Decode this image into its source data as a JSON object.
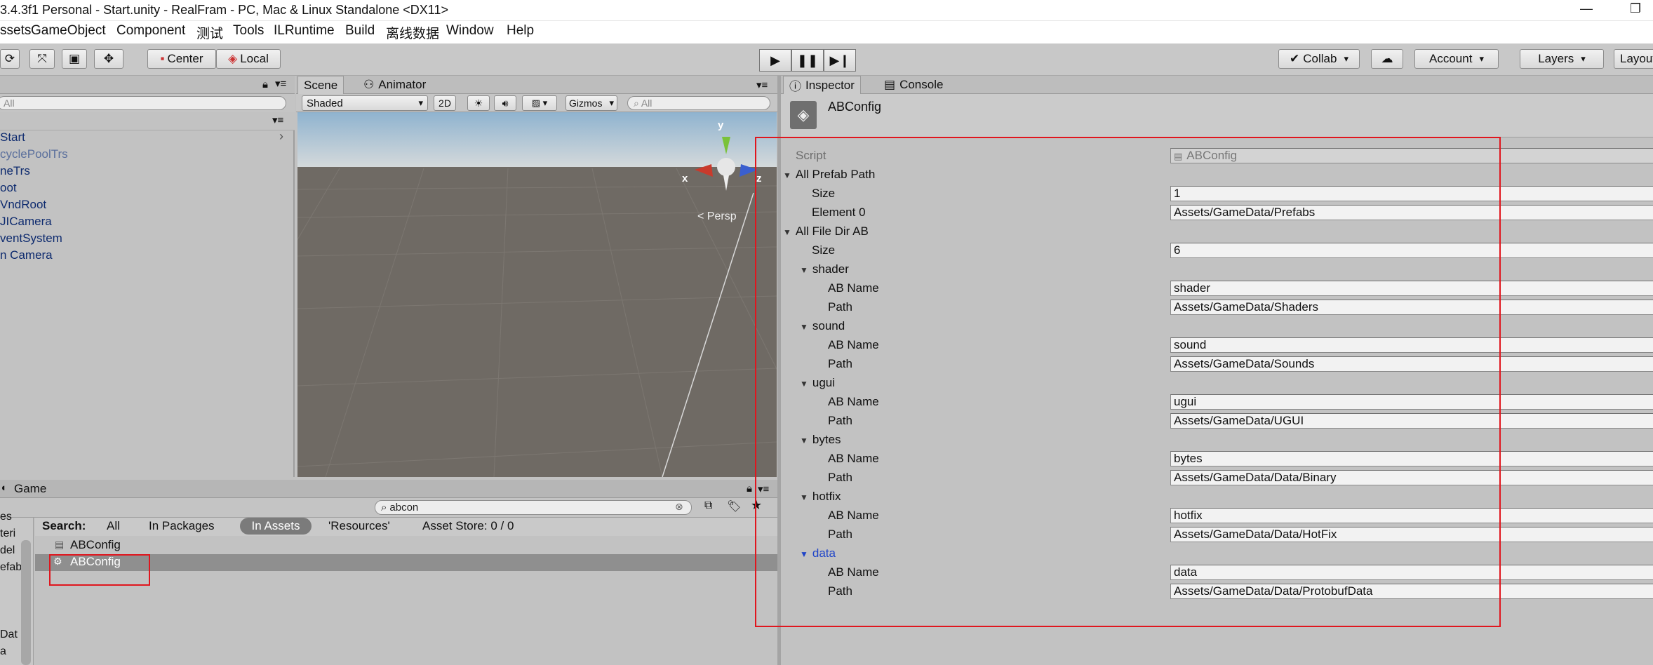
{
  "window": {
    "title": "3.4.3f1 Personal - Start.unity - RealFram - PC, Mac & Linux Standalone <DX11>"
  },
  "menu": [
    "ssets",
    "GameObject",
    "Component",
    "测试",
    "Tools",
    "ILRuntime",
    "Build",
    "离线数据",
    "Window",
    "Help"
  ],
  "toolbar": {
    "center": "Center",
    "local": "Local",
    "collab": "Collab",
    "account": "Account",
    "layers": "Layers",
    "layout": "Layout"
  },
  "hierarchy": {
    "search_placeholder": "All",
    "items": [
      "Start",
      "cyclePoolTrs",
      "neTrs",
      "oot",
      "VndRoot",
      "JICamera",
      "ventSystem",
      "n Camera"
    ]
  },
  "scene": {
    "tabs": [
      "Scene",
      "Animator"
    ],
    "shading": "Shaded",
    "mode_2d": "2D",
    "gizmos": "Gizmos",
    "search_placeholder": "All",
    "persp": "< Persp",
    "axes": {
      "x": "x",
      "y": "y",
      "z": "z"
    }
  },
  "game": {
    "tab": "Game"
  },
  "project": {
    "search_value": "abcon",
    "search_label": "Search:",
    "filters": [
      "All",
      "In Packages",
      "In Assets",
      "'Resources'",
      "Asset Store: 0 / 0"
    ],
    "results": [
      "ABConfig",
      "ABConfig"
    ],
    "left_items": [
      "es",
      "teri",
      "del",
      "efab",
      "Dat",
      "a"
    ]
  },
  "inspector": {
    "tabs": [
      "Inspector",
      "Console"
    ],
    "object_name": "ABConfig",
    "script_label": "Script",
    "script_value": "ABConfig",
    "all_prefab_path": "All Prefab Path",
    "size_label": "Size",
    "prefab_size": "1",
    "element0_label": "Element 0",
    "element0_value": "Assets/GameData/Prefabs",
    "all_file_dir_ab": "All File Dir AB",
    "dir_size": "6",
    "ab_name_label": "AB Name",
    "path_label": "Path",
    "entries": [
      {
        "title": "shader",
        "ab_name": "shader",
        "path": "Assets/GameData/Shaders"
      },
      {
        "title": "sound",
        "ab_name": "sound",
        "path": "Assets/GameData/Sounds"
      },
      {
        "title": "ugui",
        "ab_name": "ugui",
        "path": "Assets/GameData/UGUI"
      },
      {
        "title": "bytes",
        "ab_name": "bytes",
        "path": "Assets/GameData/Data/Binary"
      },
      {
        "title": "hotfix",
        "ab_name": "hotfix",
        "path": "Assets/GameData/Data/HotFix"
      },
      {
        "title": "data",
        "ab_name": "data",
        "path": "Assets/GameData/Data/ProtobufData"
      }
    ]
  },
  "colors": {
    "highlight": "#e0161e",
    "link_blue": "#1f44c8",
    "selection": "#8f8f8f"
  }
}
